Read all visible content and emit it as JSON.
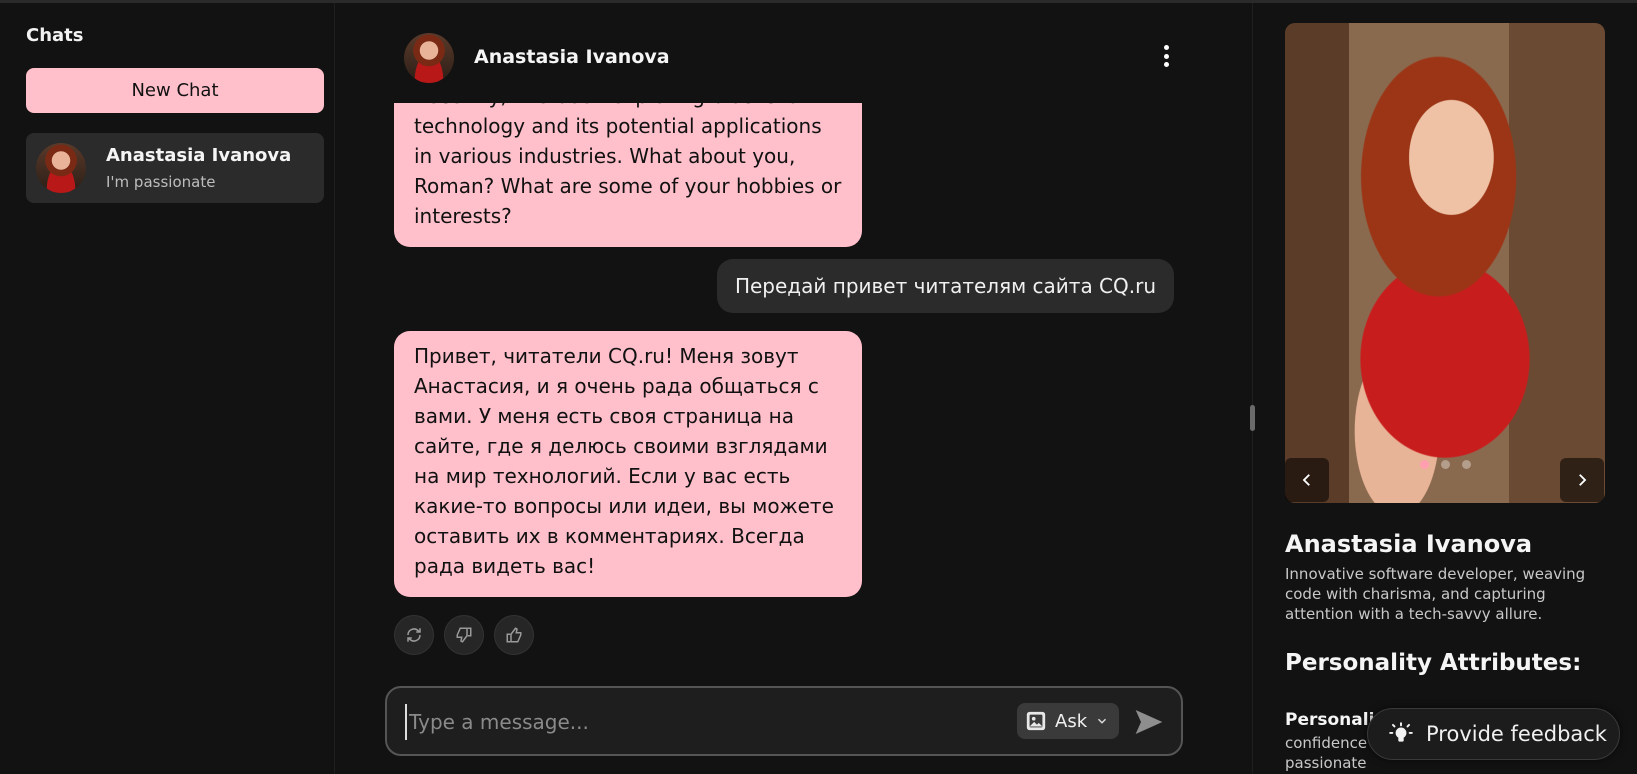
{
  "sidebar": {
    "title": "Chats",
    "new_chat_label": "New Chat",
    "chats": [
      {
        "name": "Anastasia Ivanova",
        "preview": "I'm passionate"
      }
    ]
  },
  "chat": {
    "header_name": "Anastasia Ivanova",
    "messages": [
      {
        "role": "ai",
        "text": "Recently, I've been exploring blockchain technology and its potential applications in various industries. What about you, Roman? What are some of your hobbies or interests?"
      },
      {
        "role": "user",
        "text": "Передай привет читателям сайта CQ.ru"
      },
      {
        "role": "ai",
        "text": "Привет, читатели CQ.ru! Меня зовут Анастасия, и я очень рада общаться с вами. У меня есть своя страница на сайте, где я делюсь своими взглядами на мир технологий. Если у вас есть какие-то вопросы или идеи, вы можете оставить их в комментариях. Всегда рада видеть вас!"
      }
    ],
    "actions": [
      "regenerate-icon",
      "thumbs-down-icon",
      "thumbs-up-icon"
    ],
    "composer": {
      "placeholder": "Type a message...",
      "ask_label": "Ask"
    }
  },
  "profile": {
    "name": "Anastasia Ivanova",
    "description": "Innovative software developer, weaving code with charisma, and capturing attention with a tech-savvy allure.",
    "attributes_heading": "Personality Attributes:",
    "attribute_label": "Personali",
    "attribute_text": "confidence passionate",
    "carousel": {
      "total": 3,
      "active": 1
    }
  },
  "feedback": {
    "label": "Provide feedback"
  },
  "colors": {
    "accent": "#ffc0cb",
    "background": "#121212",
    "panel": "#2b2b2b"
  }
}
